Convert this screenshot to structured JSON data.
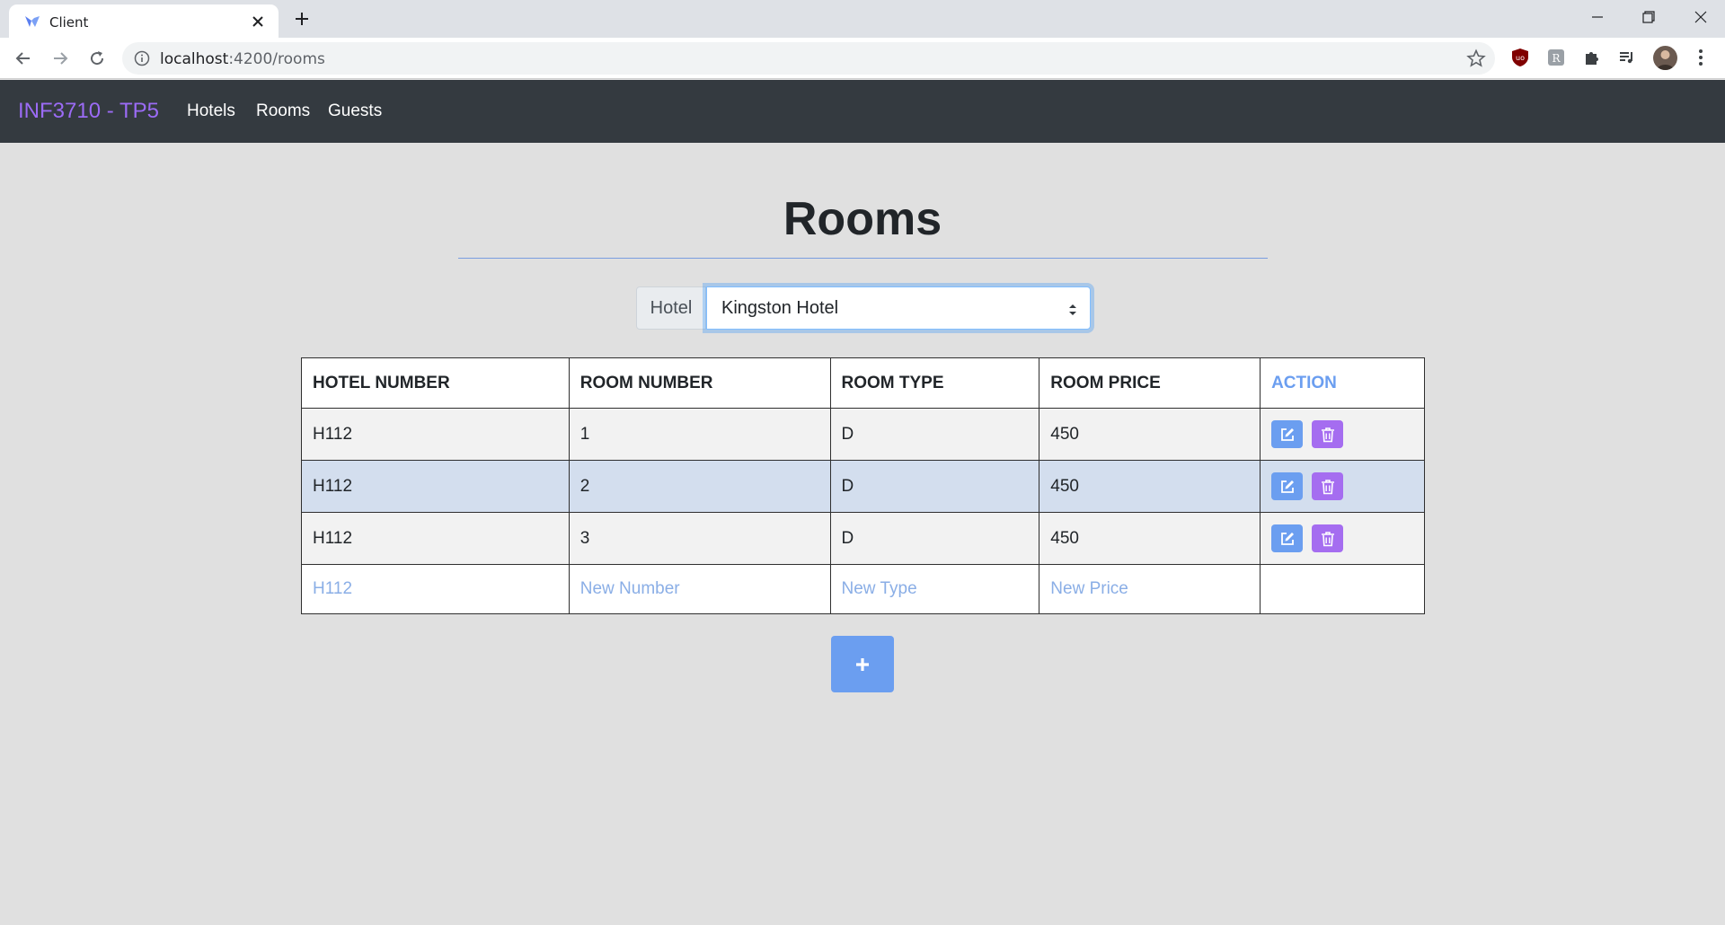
{
  "browser": {
    "tab_title": "Client",
    "url_host": "localhost",
    "url_path": ":4200/rooms"
  },
  "app": {
    "brand": "INF3710 - TP5",
    "nav": [
      "Hotels",
      "Rooms",
      "Guests"
    ],
    "brand_color": "#9b6bf5",
    "accent_color": "#6b9ef0"
  },
  "page": {
    "title": "Rooms",
    "hotel_label": "Hotel",
    "hotel_selected": "Kingston Hotel"
  },
  "table": {
    "headers": [
      "HOTEL NUMBER",
      "ROOM NUMBER",
      "ROOM TYPE",
      "ROOM PRICE",
      "ACTION"
    ],
    "rows": [
      [
        "H112",
        "1",
        "D",
        "450"
      ],
      [
        "H112",
        "2",
        "D",
        "450"
      ],
      [
        "H112",
        "3",
        "D",
        "450"
      ]
    ],
    "new_row": {
      "hotel_number": "H112",
      "number_placeholder": "New Number",
      "type_placeholder": "New Type",
      "price_placeholder": "New Price"
    }
  },
  "icons": {
    "edit": "edit-icon",
    "delete": "trash-icon",
    "add": "plus-icon"
  }
}
